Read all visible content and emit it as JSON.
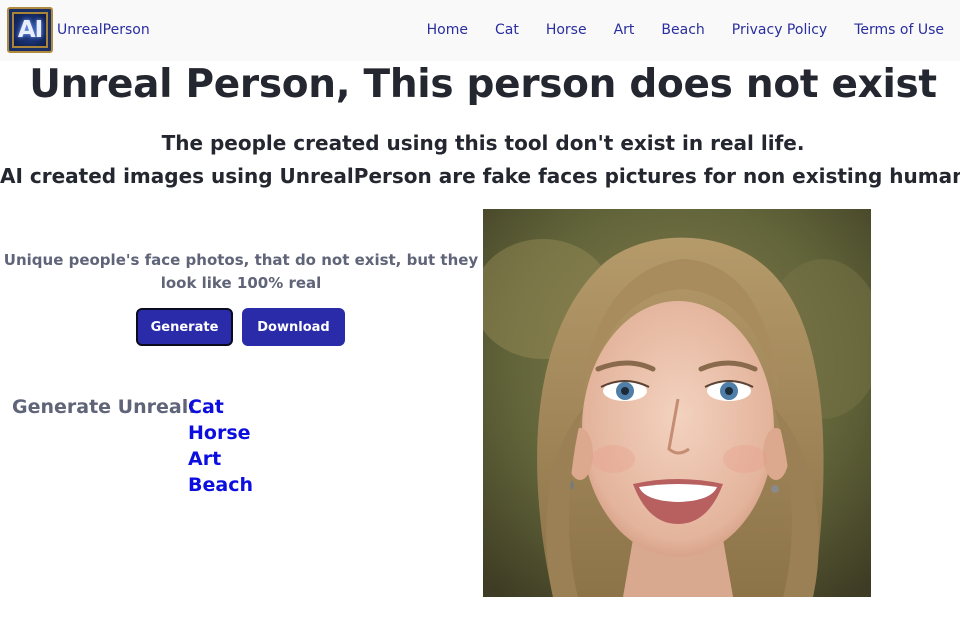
{
  "navbar": {
    "logo_text": "AI",
    "brand": "UnrealPerson",
    "links": [
      {
        "label": "Home"
      },
      {
        "label": "Cat"
      },
      {
        "label": "Horse"
      },
      {
        "label": "Art"
      },
      {
        "label": "Beach"
      },
      {
        "label": "Privacy Policy"
      },
      {
        "label": "Terms of Use"
      }
    ]
  },
  "hero": {
    "title": "Unreal Person, This person does not exist",
    "subtitle_line1": "The people created using this tool don't exist in real life.",
    "subtitle_line2": "AI created images using UnrealPerson are fake faces pictures for non existing human"
  },
  "left": {
    "tagline": "Unique people's face photos, that do not exist, but they look like 100% real",
    "generate_label": "Generate",
    "download_label": "Download",
    "generate_unreal_label": "Generate Unreal:",
    "generate_links": [
      {
        "label": "Cat"
      },
      {
        "label": "Horse"
      },
      {
        "label": "Art"
      },
      {
        "label": "Beach"
      }
    ]
  },
  "colors": {
    "accent": "#2a2ba8",
    "nav_link": "#2a2e9e",
    "generate_link": "#0c0ee0",
    "heading": "#24272f",
    "muted": "#5f6478"
  }
}
